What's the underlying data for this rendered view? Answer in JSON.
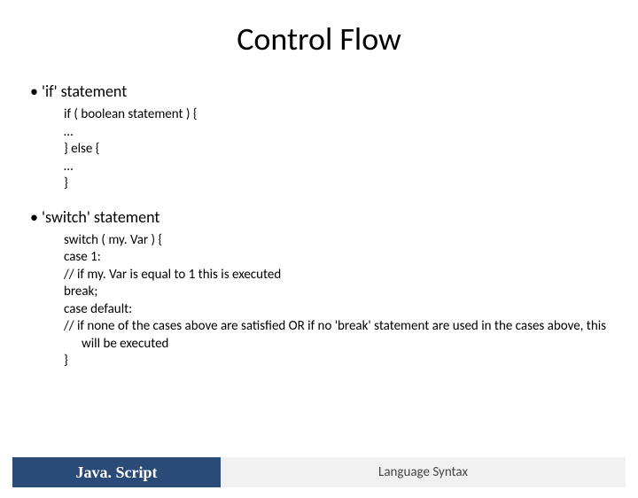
{
  "title": "Control Flow",
  "bullets": {
    "if": "• 'if' statement",
    "switch": "• 'switch' statement"
  },
  "if_code": [
    "if ( boolean statement ) {",
    "…",
    "} else {",
    "…",
    "}"
  ],
  "switch_code": [
    "switch ( my. Var ) {",
    "case 1:",
    "// if my. Var is equal to 1 this is executed",
    "break;",
    "case default:",
    "// if none of the cases above are satisfied OR if no 'break' statement are used in the cases above, this will be executed",
    "}"
  ],
  "footer": {
    "left": "Java. Script",
    "right": "Language Syntax"
  }
}
